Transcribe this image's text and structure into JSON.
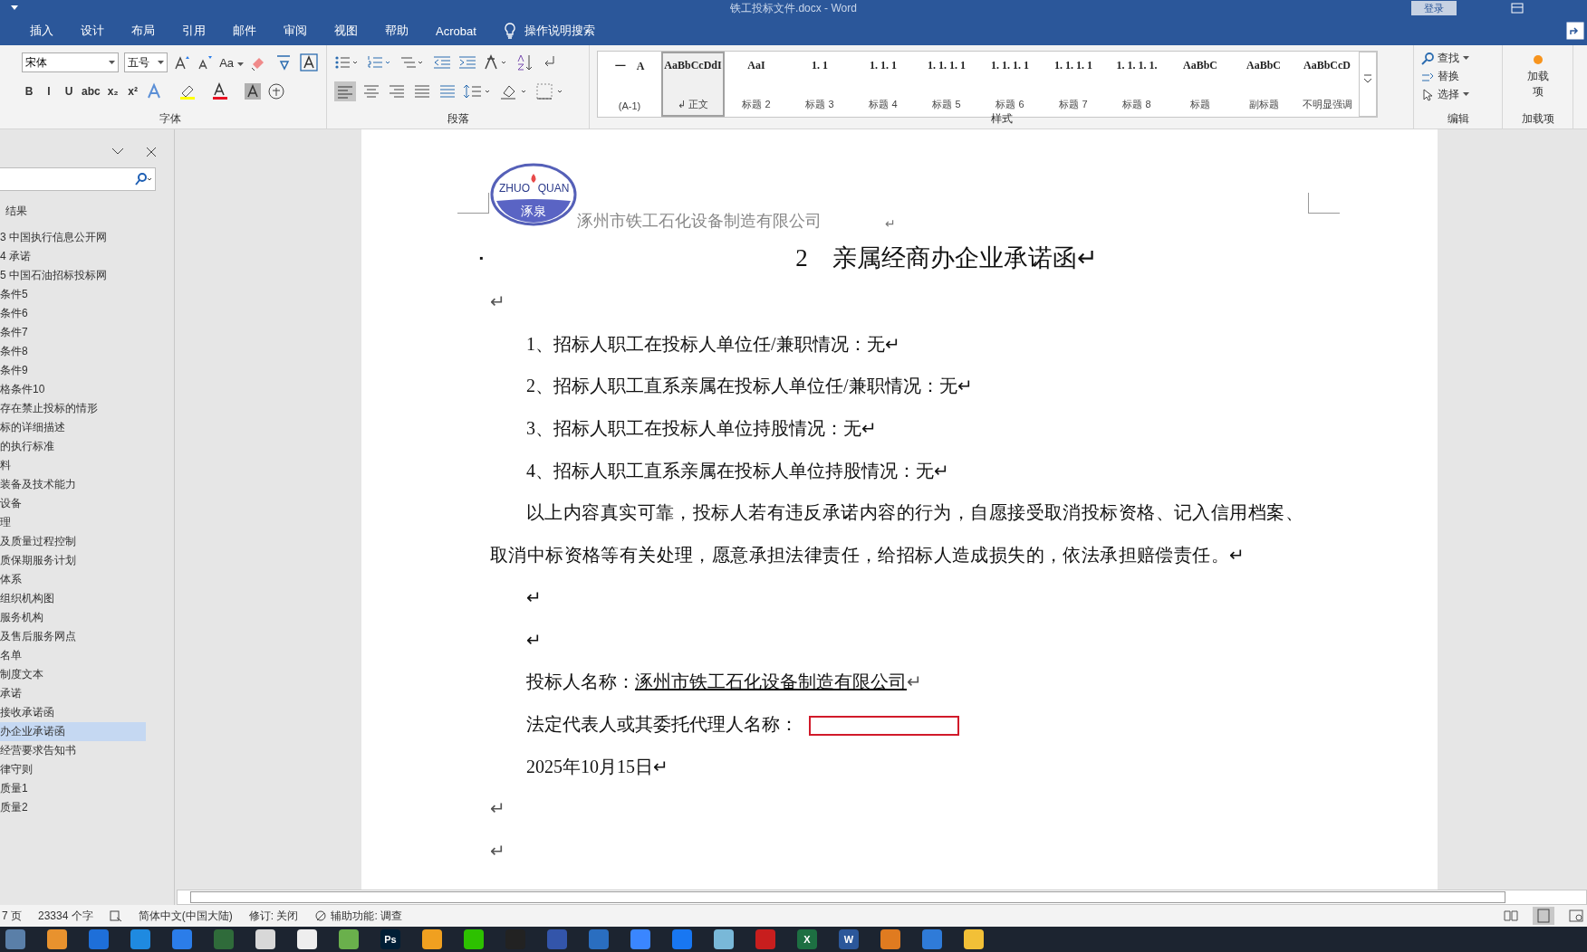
{
  "window": {
    "title": "铁工投标文件.docx - Word",
    "login": "登录"
  },
  "ribbon_tabs": [
    {
      "label": "插入",
      "selected": false
    },
    {
      "label": "设计",
      "selected": false
    },
    {
      "label": "布局",
      "selected": false
    },
    {
      "label": "引用",
      "selected": false
    },
    {
      "label": "邮件",
      "selected": false
    },
    {
      "label": "审阅",
      "selected": false
    },
    {
      "label": "视图",
      "selected": false
    },
    {
      "label": "帮助",
      "selected": false
    },
    {
      "label": "Acrobat",
      "selected": false
    }
  ],
  "tell_me": "操作说明搜索",
  "font_group": {
    "font": "宋体",
    "size": "五号",
    "case_button": "Aa",
    "format_buttons": [
      "B",
      "I",
      "U",
      "abc",
      "x₂",
      "x²"
    ],
    "label": "字体"
  },
  "paragraph_group": {
    "label": "段落"
  },
  "styles": {
    "label": "样式",
    "items": [
      {
        "preview": "一　A",
        "label": "(A-1)",
        "selected": false
      },
      {
        "preview": "AaBbCcDdI",
        "label": "↲ 正文",
        "selected": true
      },
      {
        "preview": "AaI",
        "label": "标题 2",
        "selected": false
      },
      {
        "preview": "1. 1",
        "label": "标题 3",
        "selected": false
      },
      {
        "preview": "1. 1. 1",
        "label": "标题 4",
        "selected": false
      },
      {
        "preview": "1. 1. 1. 1",
        "label": "标题 5",
        "selected": false
      },
      {
        "preview": "1. 1. 1. 1",
        "label": "标题 6",
        "selected": false
      },
      {
        "preview": "1. 1. 1. 1",
        "label": "标题 7",
        "selected": false
      },
      {
        "preview": "1. 1. 1. 1.",
        "label": "标题 8",
        "selected": false
      },
      {
        "preview": "AaBbC",
        "label": "标题",
        "selected": false
      },
      {
        "preview": "AaBbC",
        "label": "副标题",
        "selected": false
      },
      {
        "preview": "AaBbCcD",
        "label": "不明显强调",
        "selected": false
      }
    ]
  },
  "editing": {
    "label": "编辑",
    "find": "查找",
    "replace": "替换",
    "select": "选择"
  },
  "addins": {
    "button": "加载项",
    "label": "加载项"
  },
  "navigation": {
    "results": "结果",
    "items": [
      {
        "label": "3 中国执行信息公开网",
        "selected": false
      },
      {
        "label": "4 承诺",
        "selected": false
      },
      {
        "label": "5 中国石油招标投标网",
        "selected": false
      },
      {
        "label": "条件5",
        "selected": false
      },
      {
        "label": "条件6",
        "selected": false
      },
      {
        "label": "条件7",
        "selected": false
      },
      {
        "label": "条件8",
        "selected": false
      },
      {
        "label": "条件9",
        "selected": false
      },
      {
        "label": "格条件10",
        "selected": false
      },
      {
        "label": "存在禁止投标的情形",
        "selected": false
      },
      {
        "label": "标的详细描述",
        "selected": false
      },
      {
        "label": "的执行标准",
        "selected": false
      },
      {
        "label": "料",
        "selected": false
      },
      {
        "label": "装备及技术能力",
        "selected": false
      },
      {
        "label": "设备",
        "selected": false
      },
      {
        "label": "理",
        "selected": false
      },
      {
        "label": "及质量过程控制",
        "selected": false
      },
      {
        "label": "质保期服务计划",
        "selected": false
      },
      {
        "label": "体系",
        "selected": false
      },
      {
        "label": "组织机构图",
        "selected": false
      },
      {
        "label": "服务机构",
        "selected": false
      },
      {
        "label": "及售后服务网点",
        "selected": false
      },
      {
        "label": "名单",
        "selected": false
      },
      {
        "label": "制度文本",
        "selected": false
      },
      {
        "label": "承诺",
        "selected": false
      },
      {
        "label": "接收承诺函",
        "selected": false
      },
      {
        "label": "办企业承诺函",
        "selected": true
      },
      {
        "label": "经营要求告知书",
        "selected": false
      },
      {
        "label": "律守则",
        "selected": false
      },
      {
        "label": "质量1",
        "selected": false
      },
      {
        "label": "质量2",
        "selected": false
      }
    ]
  },
  "document": {
    "logo": {
      "top": "ZHUO",
      "right": "QUAN",
      "bottom": "涿泉"
    },
    "header": "涿州市铁工石化设备制造有限公司",
    "header_mark": "↵",
    "bullet": "▪",
    "title": "2　亲属经商办企业承诺函↵",
    "paragraphs": [
      {
        "kind": "mark",
        "text": "↵"
      },
      {
        "kind": "item",
        "text": "1、招标人职工在投标人单位任/兼职情况：无↵"
      },
      {
        "kind": "item",
        "text": "2、招标人职工直系亲属在投标人单位任/兼职情况：无↵"
      },
      {
        "kind": "item",
        "text": "3、招标人职工在投标人单位持股情况：无↵"
      },
      {
        "kind": "item",
        "text": "4、招标人职工直系亲属在投标人单位持股情况：无↵"
      },
      {
        "kind": "para",
        "text": "以上内容真实可靠，投标人若有违反承诺内容的行为，自愿接受取消投标资格、记入信用档案、取消中标资格等有关处理，愿意承担法律责任，给招标人造成损失的，依法承担赔偿责任。↵"
      },
      {
        "kind": "item",
        "text": "↵"
      },
      {
        "kind": "item",
        "text": "↵"
      },
      {
        "kind": "named",
        "label": "投标人名称：",
        "value": "涿州市铁工石化设备制造有限公司",
        "mark": "↵"
      },
      {
        "kind": "field",
        "label": "法定代表人或其委托代理人名称："
      },
      {
        "kind": "item",
        "text": "2025年10月15日↵"
      },
      {
        "kind": "mark",
        "text": "↵"
      },
      {
        "kind": "mark",
        "text": "↵"
      }
    ]
  },
  "status_bar": {
    "page": "7 页",
    "words": "23334 个字",
    "language": "简体中文(中国大陆)",
    "track": "修订: 关闭",
    "accessibility": "辅助功能: 调查"
  },
  "taskbar": [
    {
      "color": "#5a7fa8"
    },
    {
      "color": "#e8922e"
    },
    {
      "color": "#1e6fd9"
    },
    {
      "color": "#1f8ae0"
    },
    {
      "color": "#2b7de9"
    },
    {
      "color": "#2f6b3a"
    },
    {
      "color": "#d8d8d8"
    },
    {
      "color": "#eeeeee"
    },
    {
      "color": "#6ab04c"
    },
    {
      "color": "#001e36",
      "label": "Ps"
    },
    {
      "color": "#f0a020"
    },
    {
      "color": "#2dc100"
    },
    {
      "color": "#222222"
    },
    {
      "color": "#3355aa"
    },
    {
      "color": "#2a6ec0"
    },
    {
      "color": "#3a86ff"
    },
    {
      "color": "#1877f2"
    },
    {
      "color": "#79b8d8"
    },
    {
      "color": "#c81e1e"
    },
    {
      "color": "#1d6f42",
      "label": "X"
    },
    {
      "color": "#2b579a",
      "label": "W"
    },
    {
      "color": "#e07b20"
    },
    {
      "color": "#2f7bd8"
    },
    {
      "color": "#f2c037"
    }
  ]
}
